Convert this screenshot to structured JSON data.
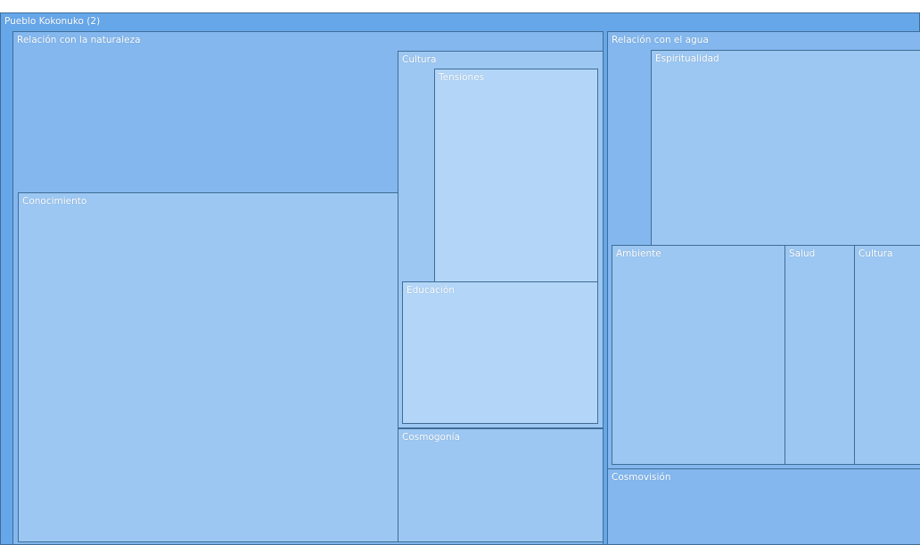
{
  "chart_data": {
    "type": "treemap",
    "title": "",
    "root": {
      "name": "Pueblo Kokonuko (2)",
      "children": [
        {
          "name": "Relación con la naturaleza",
          "children": [
            {
              "name": "Conocimiento"
            },
            {
              "name": "Cultura",
              "children": [
                {
                  "name": "Tensiones"
                },
                {
                  "name": "Educación"
                }
              ]
            },
            {
              "name": "Cosmogonía"
            }
          ]
        },
        {
          "name": "Relación con el agua",
          "children": [
            {
              "name": "Espiritualidad"
            },
            {
              "name": "Ambiente"
            },
            {
              "name": "Salud"
            },
            {
              "name": "Cultura"
            },
            {
              "name": "Cosmovisión"
            }
          ]
        }
      ]
    }
  }
}
